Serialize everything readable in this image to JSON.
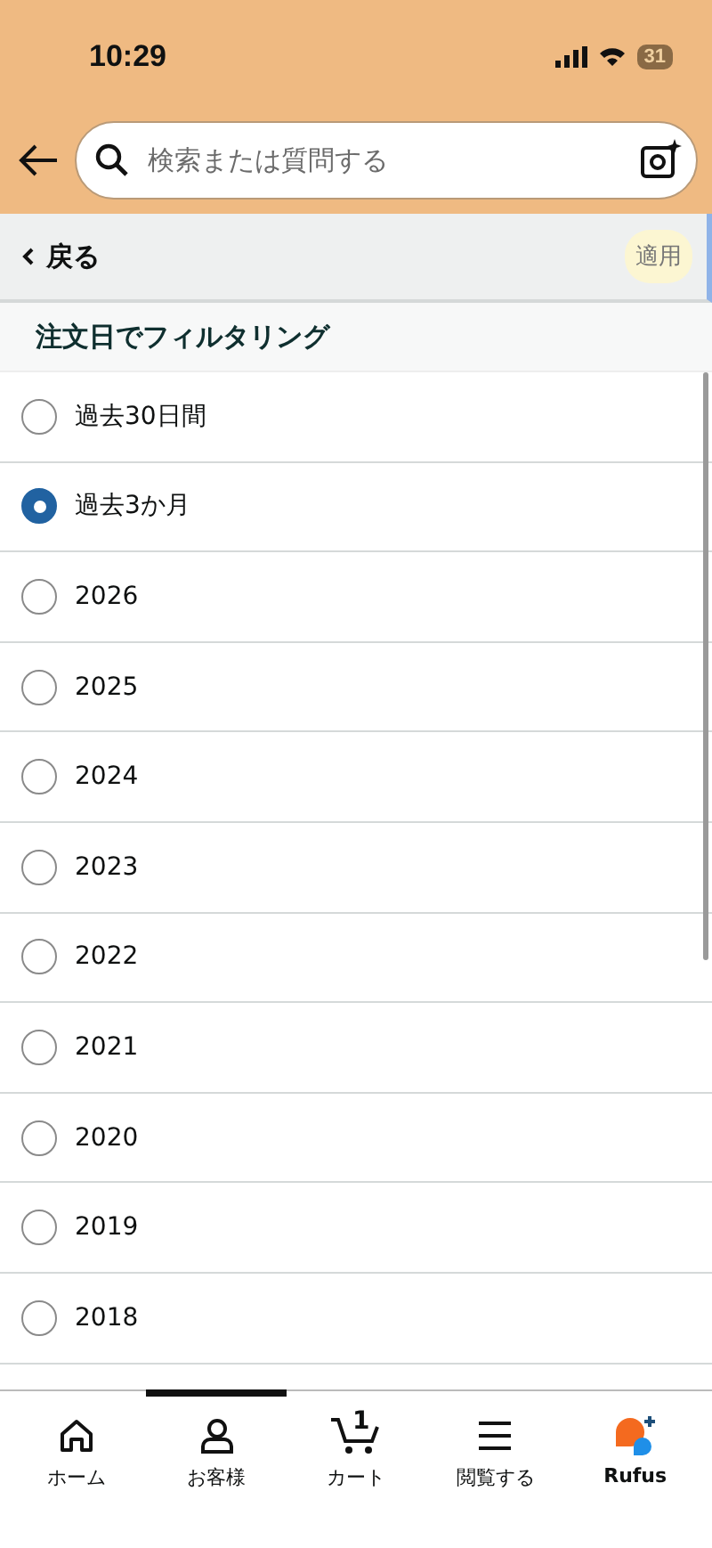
{
  "status_bar": {
    "time": "10:29",
    "battery": "31"
  },
  "search": {
    "placeholder": "検索または質問する"
  },
  "toolbar": {
    "back": "戻る",
    "apply": "適用"
  },
  "filter": {
    "title": "注文日でフィルタリング",
    "options": [
      {
        "label": "過去30日間",
        "selected": false
      },
      {
        "label": "過去3か月",
        "selected": true
      },
      {
        "label": "2026",
        "selected": false
      },
      {
        "label": "2025",
        "selected": false
      },
      {
        "label": "2024",
        "selected": false
      },
      {
        "label": "2023",
        "selected": false
      },
      {
        "label": "2022",
        "selected": false
      },
      {
        "label": "2021",
        "selected": false
      },
      {
        "label": "2020",
        "selected": false
      },
      {
        "label": "2019",
        "selected": false
      },
      {
        "label": "2018",
        "selected": false
      }
    ]
  },
  "tab_bar": [
    {
      "kind": "home",
      "label": "ホーム",
      "selected": false
    },
    {
      "kind": "account",
      "label": "お客様",
      "selected": true
    },
    {
      "kind": "cart",
      "label": "カート",
      "badge": "1",
      "selected": false
    },
    {
      "kind": "menu",
      "label": "閲覧する",
      "selected": false
    },
    {
      "kind": "rufus",
      "label": "Rufus",
      "selected": false
    }
  ]
}
